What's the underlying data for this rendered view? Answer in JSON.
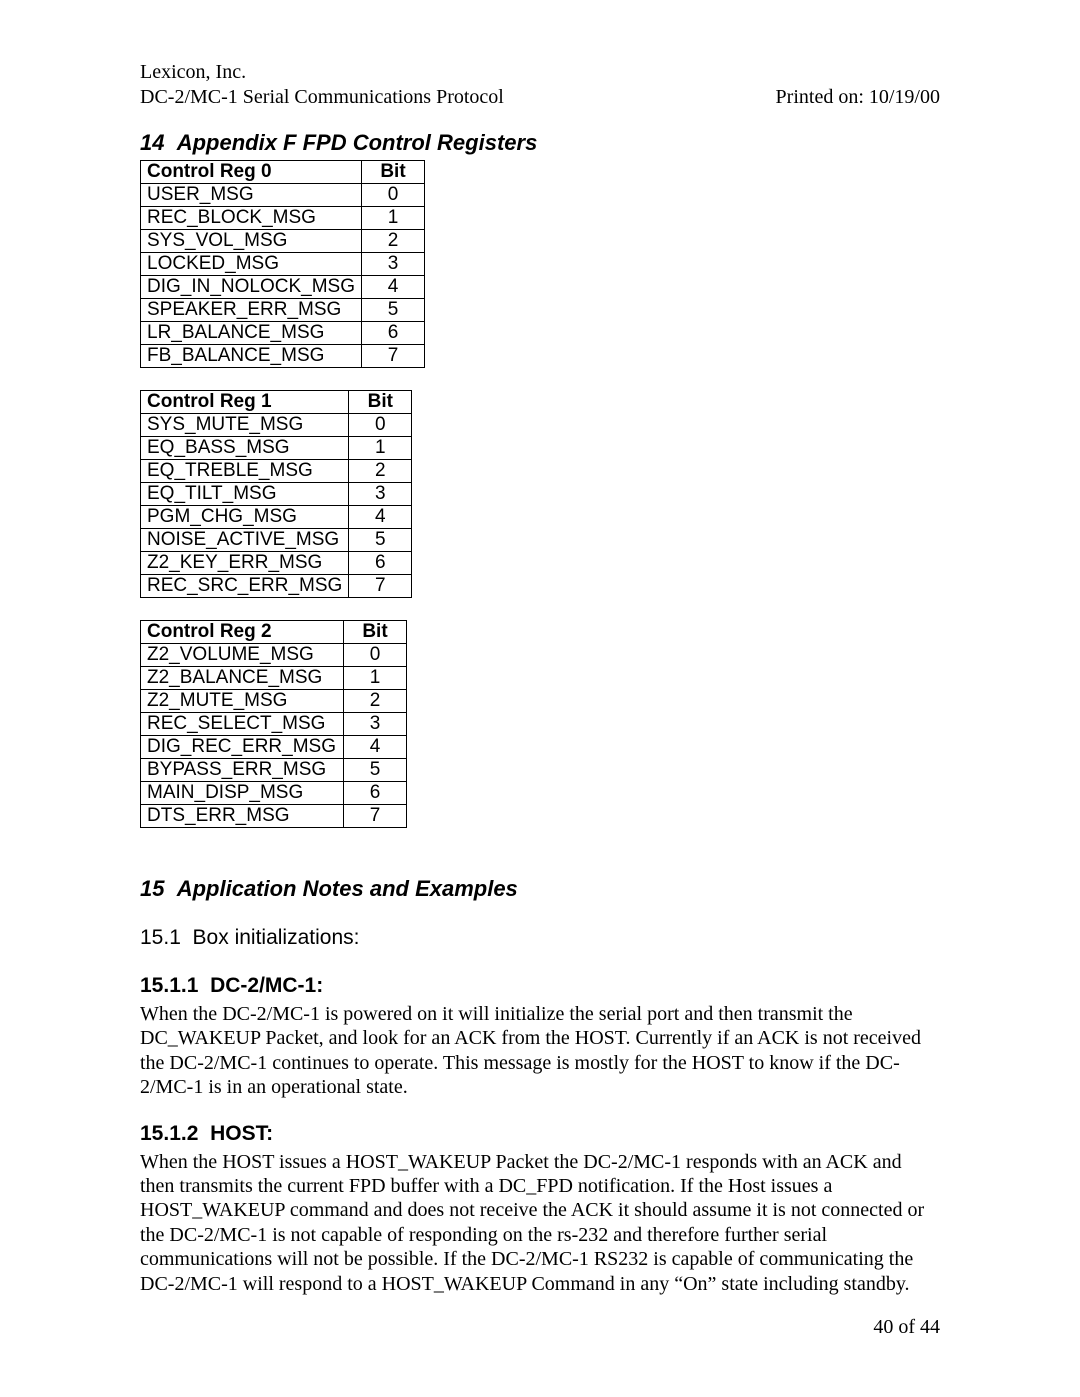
{
  "header": {
    "company": "Lexicon, Inc.",
    "doc_title": "DC-2/MC-1 Serial Communications Protocol",
    "printed_on": "Printed on: 10/19/00"
  },
  "section14": {
    "number": "14",
    "title": "Appendix F FPD Control Registers"
  },
  "tables": [
    {
      "header_name": "Control Reg 0",
      "header_bit": "Bit",
      "rows": [
        {
          "name": "USER_MSG",
          "bit": "0"
        },
        {
          "name": "REC_BLOCK_MSG",
          "bit": "1"
        },
        {
          "name": "SYS_VOL_MSG",
          "bit": "2"
        },
        {
          "name": "LOCKED_MSG",
          "bit": "3"
        },
        {
          "name": "DIG_IN_NOLOCK_MSG",
          "bit": "4"
        },
        {
          "name": "SPEAKER_ERR_MSG",
          "bit": "5"
        },
        {
          "name": "LR_BALANCE_MSG",
          "bit": "6"
        },
        {
          "name": "FB_BALANCE_MSG",
          "bit": "7"
        }
      ]
    },
    {
      "header_name": "Control Reg 1",
      "header_bit": "Bit",
      "rows": [
        {
          "name": "SYS_MUTE_MSG",
          "bit": "0"
        },
        {
          "name": "EQ_BASS_MSG",
          "bit": "1"
        },
        {
          "name": "EQ_TREBLE_MSG",
          "bit": "2"
        },
        {
          "name": "EQ_TILT_MSG",
          "bit": "3"
        },
        {
          "name": "PGM_CHG_MSG",
          "bit": "4"
        },
        {
          "name": "NOISE_ACTIVE_MSG",
          "bit": "5"
        },
        {
          "name": "Z2_KEY_ERR_MSG",
          "bit": "6"
        },
        {
          "name": "REC_SRC_ERR_MSG",
          "bit": "7"
        }
      ]
    },
    {
      "header_name": "Control Reg 2",
      "header_bit": "Bit",
      "rows": [
        {
          "name": "Z2_VOLUME_MSG",
          "bit": "0"
        },
        {
          "name": "Z2_BALANCE_MSG",
          "bit": "1"
        },
        {
          "name": "Z2_MUTE_MSG",
          "bit": "2"
        },
        {
          "name": "REC_SELECT_MSG",
          "bit": "3"
        },
        {
          "name": "DIG_REC_ERR_MSG",
          "bit": "4"
        },
        {
          "name": "BYPASS_ERR_MSG",
          "bit": "5"
        },
        {
          "name": "MAIN_DISP_MSG",
          "bit": "6"
        },
        {
          "name": "DTS_ERR_MSG",
          "bit": "7"
        }
      ]
    }
  ],
  "section15": {
    "number": "15",
    "title": "Application Notes and Examples"
  },
  "sub_15_1": {
    "number": "15.1",
    "title": "Box initializations:"
  },
  "sub_15_1_1": {
    "number": "15.1.1",
    "title": "DC-2/MC-1:",
    "body": "When the DC-2/MC-1 is powered on it will initialize the serial port and then transmit the DC_WAKEUP Packet, and look for an ACK from the HOST.  Currently if an ACK is not received the DC-2/MC-1 continues to operate.  This message is mostly for the HOST to know if the DC-2/MC-1 is in an operational state."
  },
  "sub_15_1_2": {
    "number": "15.1.2",
    "title": "HOST:",
    "body": " When the HOST issues a HOST_WAKEUP Packet  the DC-2/MC-1 responds with an ACK and then transmits the current FPD buffer with a DC_FPD notification.  If the Host issues a HOST_WAKEUP command and does not receive the ACK it should assume it is not connected or the DC-2/MC-1 is not capable of  responding on the rs-232 and therefore further serial communications will not be possible.  If the DC-2/MC-1 RS232 is capable  of communicating  the DC-2/MC-1 will respond to a HOST_WAKEUP Command in any “On” state including standby."
  },
  "footer": {
    "page": "40 of 44"
  }
}
